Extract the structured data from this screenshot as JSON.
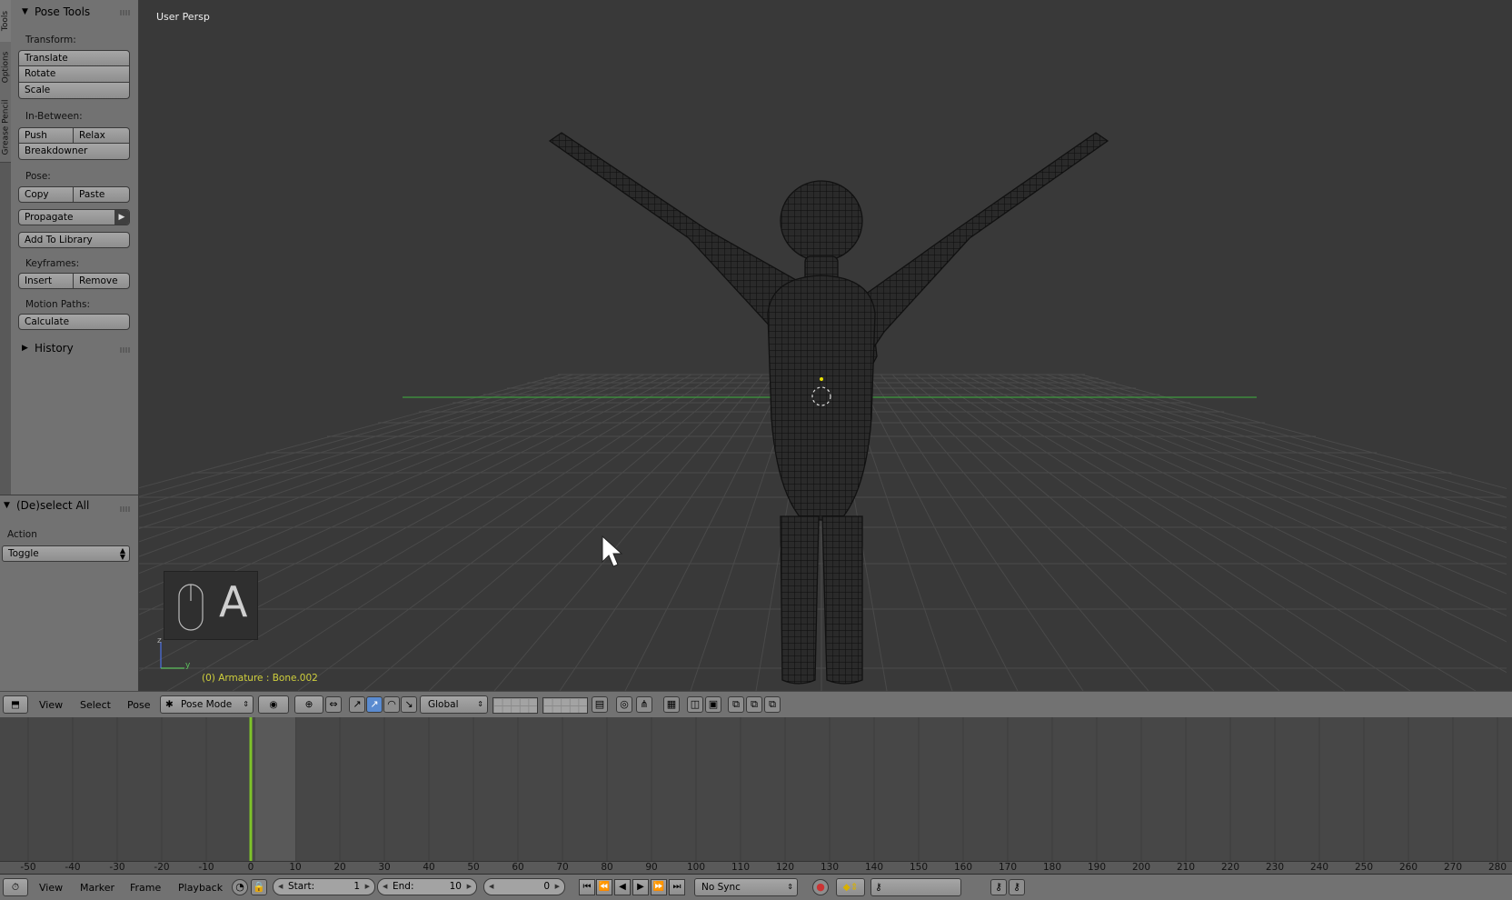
{
  "tool_shelf": {
    "tabs": [
      "Tools",
      "Options",
      "Grease Pencil"
    ],
    "panel_title": "Pose Tools",
    "transform_label": "Transform:",
    "translate": "Translate",
    "rotate": "Rotate",
    "scale": "Scale",
    "inbetween_label": "In-Between:",
    "push": "Push",
    "relax": "Relax",
    "breakdowner": "Breakdowner",
    "pose_label": "Pose:",
    "copy": "Copy",
    "paste": "Paste",
    "propagate": "Propagate",
    "add_to_library": "Add To Library",
    "keyframes_label": "Keyframes:",
    "insert": "Insert",
    "remove": "Remove",
    "motion_paths_label": "Motion Paths:",
    "calculate": "Calculate",
    "history": "History"
  },
  "operator": {
    "title": "(De)select All",
    "action_label": "Action",
    "action_value": "Toggle"
  },
  "viewport": {
    "title": "User Persp",
    "status": "(0) Armature : Bone.002",
    "key_pressed": "A",
    "axis_z": "z",
    "axis_y": "y"
  },
  "view3d_header": {
    "view": "View",
    "select": "Select",
    "pose": "Pose",
    "mode": "Pose Mode",
    "orientation": "Global"
  },
  "timeline": {
    "frame_ticks": [
      "-50",
      "-40",
      "-30",
      "-20",
      "-10",
      "0",
      "10",
      "20",
      "30",
      "40",
      "50",
      "60",
      "70",
      "80",
      "90",
      "100",
      "110",
      "120",
      "130",
      "140",
      "150",
      "160",
      "170",
      "180",
      "190",
      "200",
      "210",
      "220",
      "230",
      "240",
      "250",
      "260",
      "270",
      "280"
    ],
    "current_frame": 0,
    "view": "View",
    "marker": "Marker",
    "frame": "Frame",
    "playback": "Playback",
    "start_label": "Start:",
    "start_value": "1",
    "end_label": "End:",
    "end_value": "10",
    "current_value": "0",
    "sync": "No Sync"
  },
  "colors": {
    "current_frame_line": "#7ec32a",
    "grid_x_axis": "#3f9a3f",
    "status_text": "#cfcf3c"
  }
}
